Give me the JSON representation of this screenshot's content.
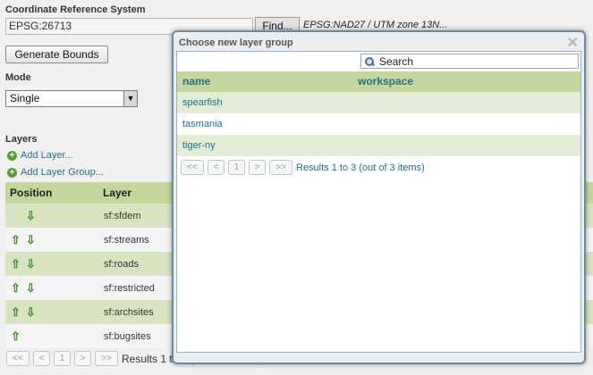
{
  "crs": {
    "label": "Coordinate Reference System",
    "value": "EPSG:26713",
    "find_label": "Find...",
    "description": "EPSG:NAD27 / UTM zone 13N..."
  },
  "generate_bounds_label": "Generate Bounds",
  "mode": {
    "label": "Mode",
    "value": "Single"
  },
  "layers": {
    "label": "Layers",
    "add_layer": "Add Layer...",
    "add_layer_group": "Add Layer Group...",
    "columns": [
      "Position",
      "Layer"
    ],
    "rows": [
      {
        "name": "sf:sfdem",
        "up": false,
        "down": true
      },
      {
        "name": "sf:streams",
        "up": true,
        "down": true
      },
      {
        "name": "sf:roads",
        "up": true,
        "down": true
      },
      {
        "name": "sf:restricted",
        "up": true,
        "down": true
      },
      {
        "name": "sf:archsites",
        "up": true,
        "down": true
      },
      {
        "name": "sf:bugsites",
        "up": true,
        "down": false
      }
    ],
    "pager": {
      "first": "<<",
      "prev": "<",
      "page": "1",
      "next": ">",
      "last": ">>",
      "summary": "Results 1 to 6 (out of 6 items)"
    }
  },
  "dialog": {
    "title": "Choose new layer group",
    "close_icon": "close-icon",
    "search_placeholder": "Search",
    "columns": [
      "name",
      "workspace"
    ],
    "rows": [
      {
        "name": "spearfish",
        "workspace": ""
      },
      {
        "name": "tasmania",
        "workspace": ""
      },
      {
        "name": "tiger-ny",
        "workspace": ""
      }
    ],
    "pager": {
      "first": "<<",
      "prev": "<",
      "page": "1",
      "next": ">",
      "last": ">>",
      "summary": "Results 1 to 3 (out of 3 items)"
    }
  },
  "colors": {
    "header_green": "#c3d69b",
    "link_teal": "#1f6f8b",
    "arrow_green": "#3c8a2a"
  }
}
